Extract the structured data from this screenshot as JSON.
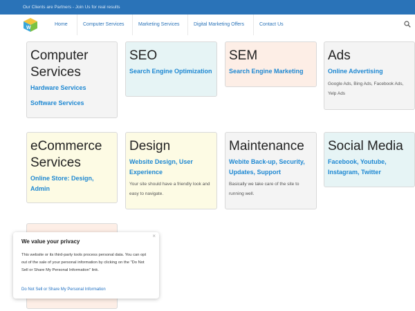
{
  "topbar": {
    "text": "Our Clients are Partners - Join Us for real results"
  },
  "nav": {
    "items": [
      "Home",
      "Computer Services",
      "Marketing Services",
      "Digital Marketing Offers",
      "Contact Us"
    ],
    "search_icon": "search-icon"
  },
  "cards": [
    {
      "title": "Computer Services",
      "links": [
        "Hardware Services",
        "Software Services"
      ],
      "desc": ""
    },
    {
      "title": "SEO",
      "links": [
        "Search Engine Optimization"
      ],
      "desc": ""
    },
    {
      "title": "SEM",
      "links": [
        "Search Engine Marketing"
      ],
      "desc": ""
    },
    {
      "title": "Ads",
      "links": [
        "Online Advertising"
      ],
      "desc": "Google Ads, Bing Ads, Facebook Ads, Yelp Ads"
    },
    {
      "title": "eCommerce Services",
      "links": [
        "Online Store: Design, Admin"
      ],
      "desc": ""
    },
    {
      "title": "Design",
      "links": [
        "Website Design, User Experience"
      ],
      "desc": "Your site should have a friendly look and easy to navigate."
    },
    {
      "title": "Maintenance",
      "links": [
        "Webite Back-up, Security, Updates, Support"
      ],
      "desc": "Basically we take care of the site to running well."
    },
    {
      "title": "Social Media",
      "links": [
        "Facebook, Youtube, Instagram, Twitter"
      ],
      "desc": ""
    }
  ],
  "privacy": {
    "title": "We value your privacy",
    "body": "This website or its third-party tools process personal data. You can opt out of the sale of your personal information by clicking on the \"Do Not Sell or Share My Personal Information\" link.",
    "link": "Do Not Sell or Share My Personal Information",
    "close": "×"
  },
  "colors": {
    "topbar": "#2a73b8",
    "link": "#1e88d2"
  }
}
